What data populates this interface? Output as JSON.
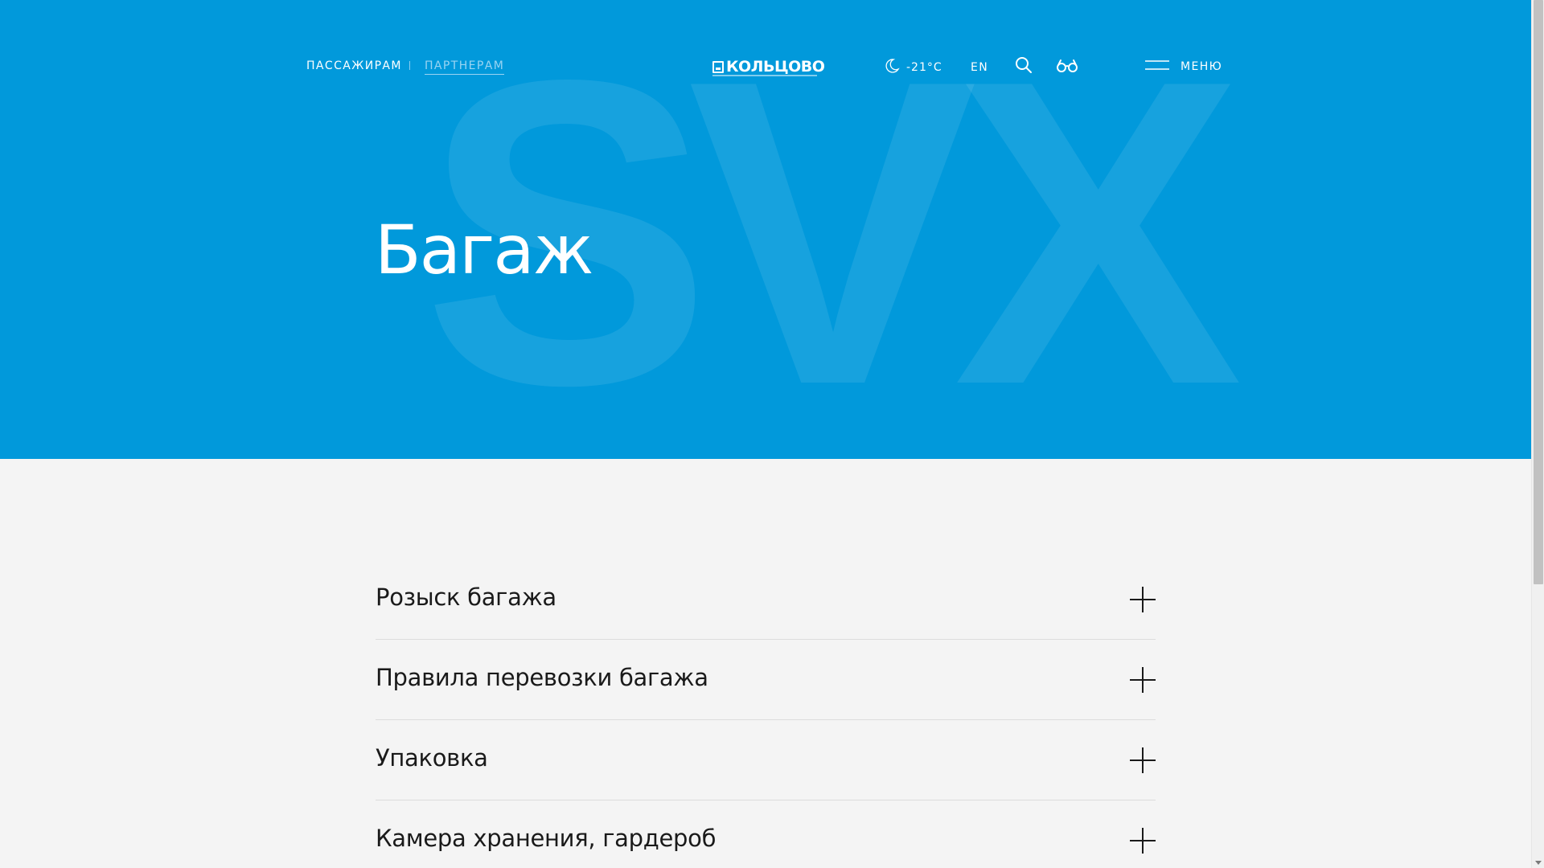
{
  "hero": {
    "watermark": "SVX",
    "title": "Багаж",
    "background_color": "#0199db"
  },
  "header": {
    "nav": {
      "passengers": "ПАССАЖИРАМ",
      "partners": "ПАРТНЕРАМ"
    },
    "logo": "КОЛЬЦОВО",
    "weather": {
      "icon": "moon-icon",
      "temperature": "-21°C"
    },
    "language": "EN",
    "search_icon": "search-icon",
    "accessibility_icon": "glasses-icon",
    "menu_label": "МЕНЮ"
  },
  "accordion": {
    "items": [
      {
        "label": "Розыск багажа"
      },
      {
        "label": "Правила перевозки багажа"
      },
      {
        "label": "Упаковка"
      },
      {
        "label": "Камера хранения, гардероб"
      }
    ]
  }
}
